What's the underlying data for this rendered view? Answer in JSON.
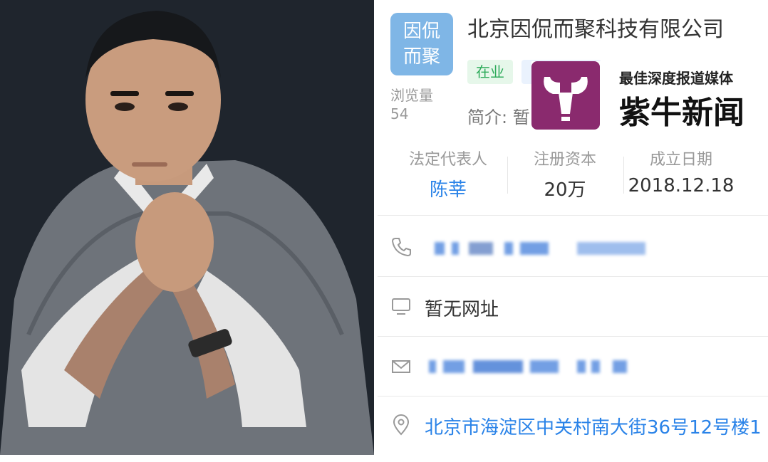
{
  "company": {
    "logo_line1": "因侃",
    "logo_line2": "而聚",
    "name": "北京因侃而聚科技有限公司",
    "status_badge": "在业",
    "views_label": "浏览量",
    "views_value": "54",
    "intro": "简介: 暂"
  },
  "watermark": {
    "slogan": "最佳深度报道媒体",
    "name": "紫牛新闻",
    "brand_color": "#8a2a6e"
  },
  "stats": [
    {
      "label": "法定代表人",
      "value": "陈莘"
    },
    {
      "label": "注册资本",
      "value": "20万"
    },
    {
      "label": "成立日期",
      "value": "2018.12.18"
    }
  ],
  "contact": {
    "phone_partial": "3",
    "website": "暂无网址",
    "email_partial": "21 @",
    "address": "北京市海淀区中关村南大街36号12号楼1"
  },
  "colors": {
    "link_blue": "#2a83e8",
    "status_green": "#2dab5a",
    "logo_bg": "#7fb6e6"
  }
}
